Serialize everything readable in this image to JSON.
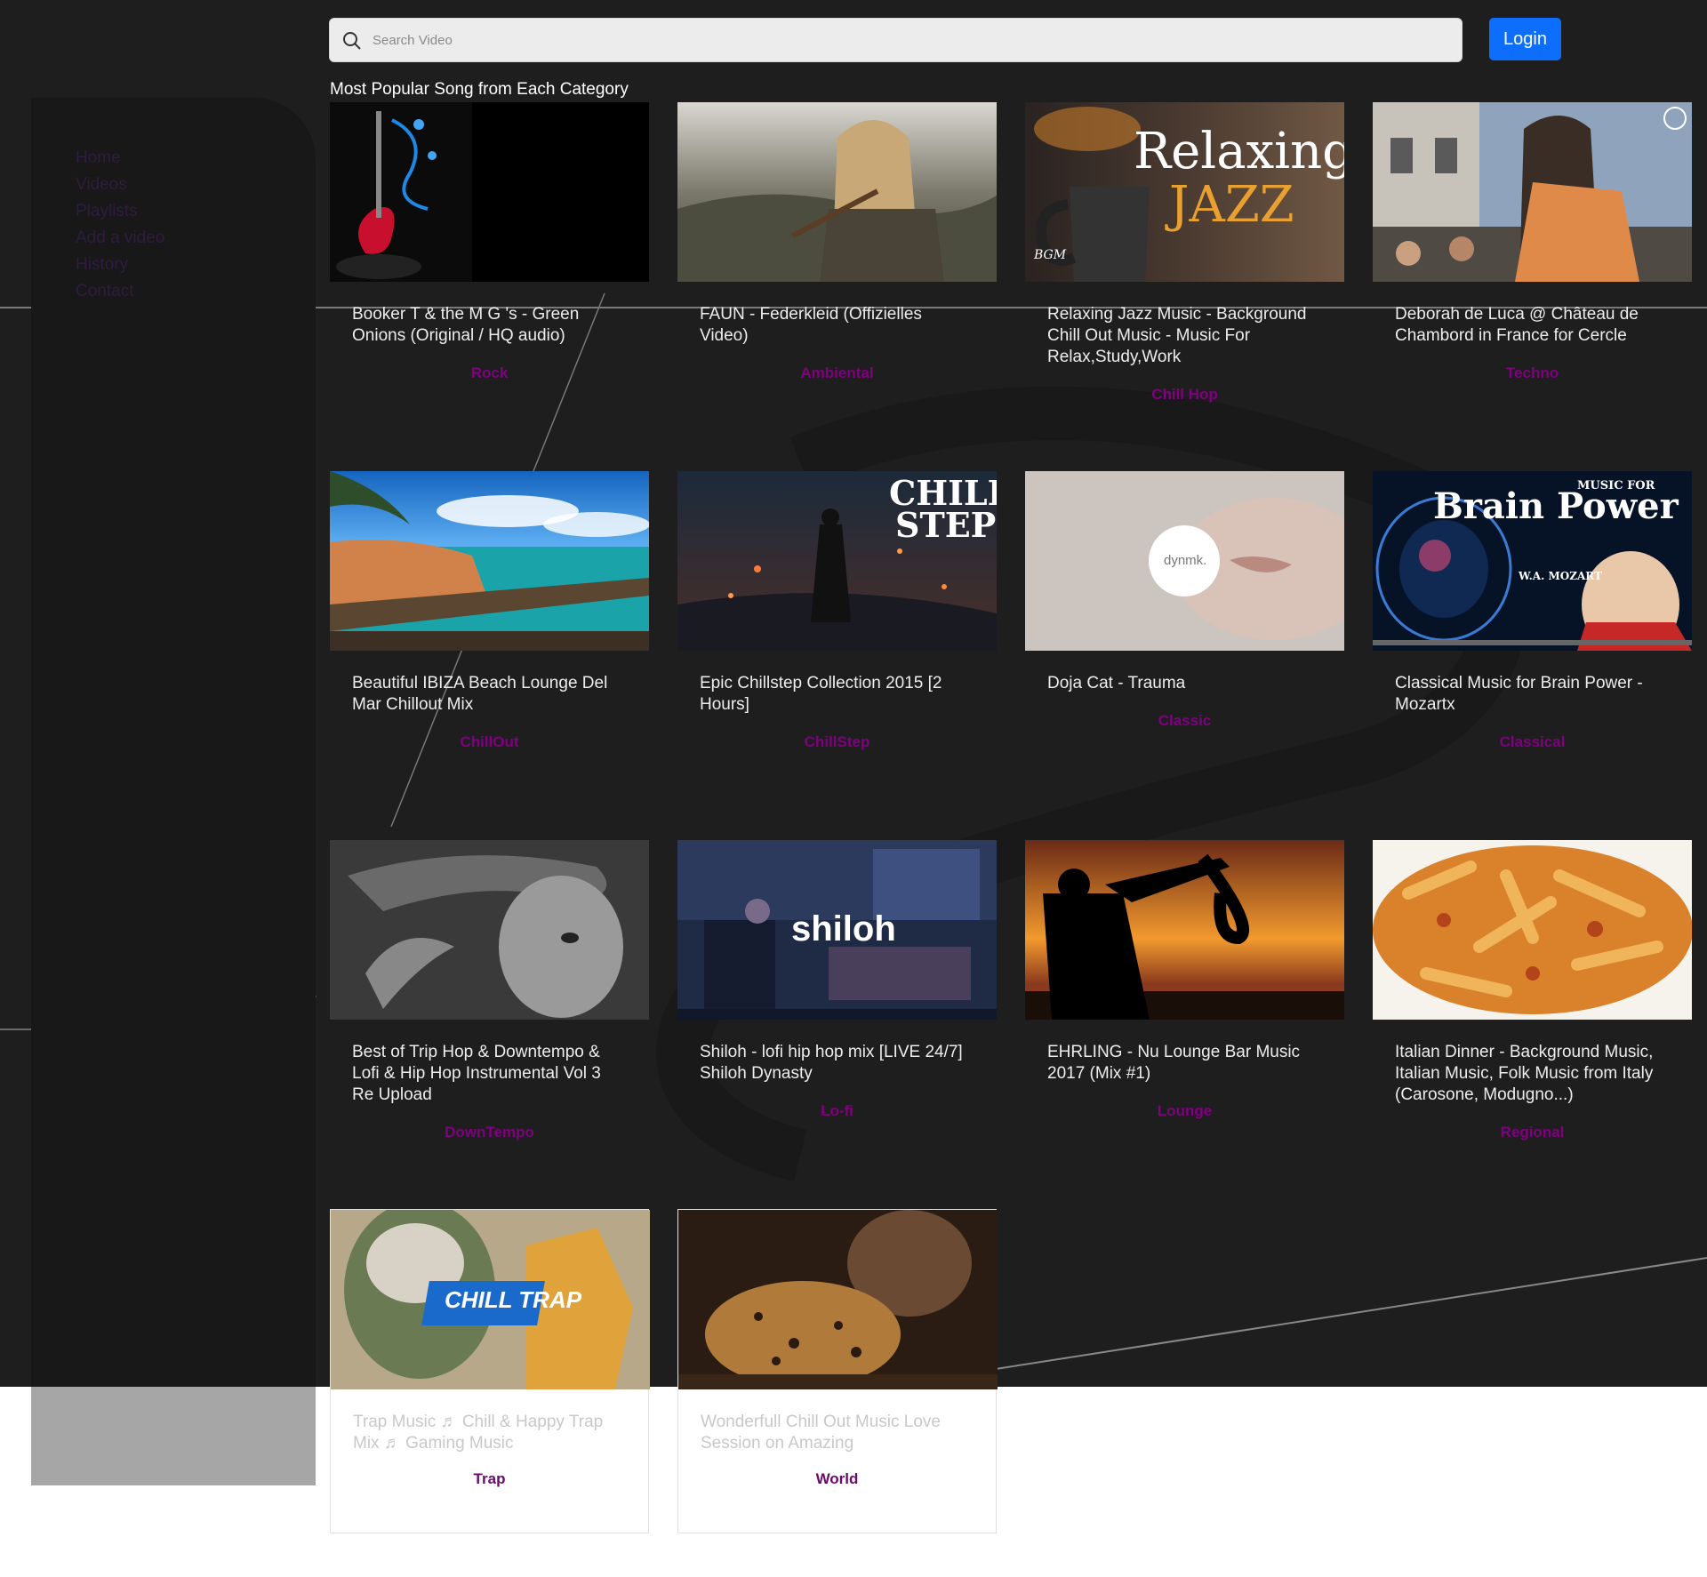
{
  "search": {
    "placeholder": "Search Video"
  },
  "header": {
    "login_label": "Login"
  },
  "sidebar": {
    "items": [
      {
        "label": "Home"
      },
      {
        "label": "Videos"
      },
      {
        "label": "Playlists"
      },
      {
        "label": "Add a video"
      },
      {
        "label": "History"
      },
      {
        "label": "Contact"
      }
    ]
  },
  "main": {
    "section_title": "Most Popular Song from Each Category",
    "videos": [
      {
        "title": "Booker T & the M G 's - Green Onions (Original / HQ audio)",
        "category": "Rock"
      },
      {
        "title": "FAUN - Federkleid (Offizielles Video)",
        "category": "Ambiental"
      },
      {
        "title": "Relaxing Jazz Music - Background Chill Out Music - Music For Relax,Study,Work",
        "category": "Chill Hop",
        "thumb_text": [
          "Relaxing",
          "JAZZ",
          "BGM"
        ]
      },
      {
        "title": "Deborah de Luca @ Château de Chambord in France for Cercle",
        "category": "Techno"
      },
      {
        "title": "Beautiful IBIZA Beach Lounge Del Mar Chillout Mix",
        "category": "ChillOut"
      },
      {
        "title": "Epic Chillstep Collection 2015 [2 Hours]",
        "category": "ChillStep",
        "thumb_text": [
          "CHILL",
          "STEP"
        ]
      },
      {
        "title": "Doja Cat - Trauma",
        "category": "Classic",
        "thumb_text": [
          "dynmk."
        ]
      },
      {
        "title": "Classical Music for Brain Power - Mozartx",
        "category": "Classical",
        "thumb_text": [
          "MUSIC FOR",
          "Brain Power",
          "W.A. MOZART"
        ]
      },
      {
        "title": "Best of Trip Hop & Downtempo & Lofi & Hip Hop Instrumental Vol 3 Re Upload",
        "category": "DownTempo"
      },
      {
        "title": "Shiloh - lofi hip hop mix [LIVE 24/7] Shiloh Dynasty",
        "category": "Lo-fi",
        "thumb_text": [
          "shiloh"
        ]
      },
      {
        "title": "EHRLING - Nu Lounge Bar Music 2017 (Mix #1)",
        "category": "Lounge"
      },
      {
        "title": "Italian Dinner - Background Music, Italian Music, Folk Music from Italy (Carosone, Modugno...)",
        "category": "Regional"
      },
      {
        "title": "Trap Music ♬ Chill & Happy Trap Mix ♬ Gaming Music",
        "category": "Trap",
        "thumb_text": [
          "CHILL TRAP"
        ]
      },
      {
        "title": "Wonderfull Chill Out Music Love Session on Amazing",
        "category": "World"
      }
    ]
  },
  "colors": {
    "accent": "#0d6efd",
    "category": "#800080",
    "background": "#1e1e1f"
  }
}
